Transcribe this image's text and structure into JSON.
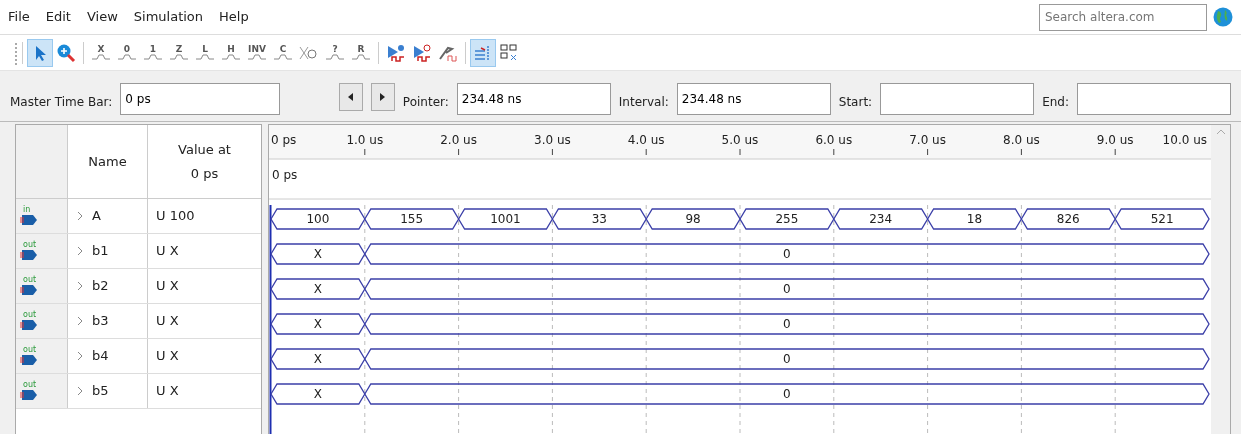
{
  "menu": [
    "File",
    "Edit",
    "View",
    "Simulation",
    "Help"
  ],
  "search": {
    "placeholder": "Search altera.com"
  },
  "toolbar_groups": [
    [
      {
        "kind": "pointer",
        "selected": true
      },
      {
        "kind": "zoom",
        "selected": false
      }
    ],
    [
      {
        "kind": "glyph",
        "glyph": "X",
        "selected": false
      },
      {
        "kind": "glyph",
        "glyph": "0",
        "selected": false
      },
      {
        "kind": "glyph",
        "glyph": "1",
        "selected": false
      },
      {
        "kind": "glyph",
        "glyph": "Z",
        "selected": false
      },
      {
        "kind": "glyph",
        "glyph": "L",
        "selected": false
      },
      {
        "kind": "glyph",
        "glyph": "H",
        "selected": false
      },
      {
        "kind": "glyph",
        "glyph": "INV",
        "selected": false
      },
      {
        "kind": "glyph",
        "glyph": "C",
        "selected": false
      },
      {
        "kind": "clock",
        "selected": false
      },
      {
        "kind": "glyph",
        "glyph": "?",
        "selected": false
      },
      {
        "kind": "glyph",
        "glyph": "R",
        "selected": false
      }
    ],
    [
      {
        "kind": "run",
        "selected": false
      },
      {
        "kind": "run-timed",
        "selected": false
      },
      {
        "kind": "hammer",
        "selected": false
      }
    ],
    [
      {
        "kind": "snap",
        "selected": true
      },
      {
        "kind": "group",
        "selected": false
      }
    ]
  ],
  "time_bar": {
    "master_label": "Master Time Bar:",
    "master_value": "0 ps",
    "pointer_label": "Pointer:",
    "pointer_value": "234.48 ns",
    "interval_label": "Interval:",
    "interval_value": "234.48 ns",
    "start_label": "Start:",
    "end_label": "End:"
  },
  "table": {
    "name_header": "Name",
    "value_header": "Value at",
    "value_time": "0 ps"
  },
  "signals": [
    {
      "direction": "in",
      "name": "A",
      "value": "U 100",
      "expanded": false,
      "segments": [
        {
          "value": "100"
        },
        {
          "value": "155"
        },
        {
          "value": "1001"
        },
        {
          "value": "33"
        },
        {
          "value": "98"
        },
        {
          "value": "255"
        },
        {
          "value": "234"
        },
        {
          "value": "18"
        },
        {
          "value": "826"
        },
        {
          "value": "521"
        }
      ]
    },
    {
      "direction": "out",
      "name": "b1",
      "value": "U X",
      "expanded": false,
      "segments": [
        {
          "value": "X"
        },
        {
          "value": "0"
        }
      ]
    },
    {
      "direction": "out",
      "name": "b2",
      "value": "U X",
      "expanded": false,
      "segments": [
        {
          "value": "X"
        },
        {
          "value": "0"
        }
      ]
    },
    {
      "direction": "out",
      "name": "b3",
      "value": "U X",
      "expanded": false,
      "segments": [
        {
          "value": "X"
        },
        {
          "value": "0"
        }
      ]
    },
    {
      "direction": "out",
      "name": "b4",
      "value": "U X",
      "expanded": false,
      "segments": [
        {
          "value": "X"
        },
        {
          "value": "0"
        }
      ]
    },
    {
      "direction": "out",
      "name": "b5",
      "value": "U X",
      "expanded": false,
      "segments": [
        {
          "value": "X"
        },
        {
          "value": "0"
        }
      ]
    }
  ],
  "wave": {
    "ticks": [
      "0 ps",
      "1.0 us",
      "2.0 us",
      "3.0 us",
      "4.0 us",
      "5.0 us",
      "6.0 us",
      "7.0 us",
      "8.0 us",
      "9.0 us",
      "10.0 us"
    ],
    "cursor_label": "0 ps"
  }
}
